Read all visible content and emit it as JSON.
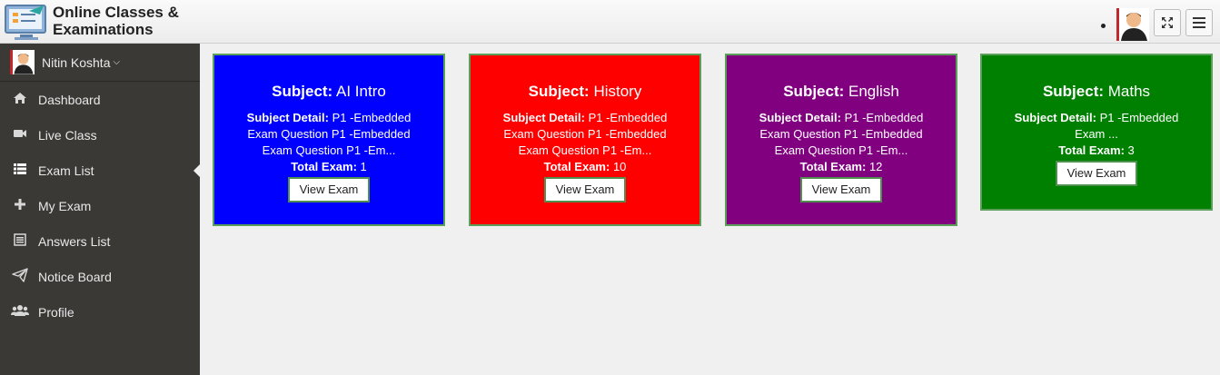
{
  "header": {
    "brand_line1": "Online Classes &",
    "brand_line2": "Examinations"
  },
  "sidebar": {
    "user_name": "Nitin Koshta",
    "items": [
      {
        "label": "Dashboard",
        "icon": "home-icon"
      },
      {
        "label": "Live Class",
        "icon": "video-camera-icon"
      },
      {
        "label": "Exam List",
        "icon": "list-icon",
        "active": true
      },
      {
        "label": "My Exam",
        "icon": "plus-icon"
      },
      {
        "label": "Answers List",
        "icon": "list-alt-icon"
      },
      {
        "label": "Notice Board",
        "icon": "paper-plane-icon"
      },
      {
        "label": "Profile",
        "icon": "users-icon"
      }
    ]
  },
  "labels": {
    "subject": "Subject:",
    "subject_detail": "Subject Detail:",
    "total_exam": "Total Exam:",
    "view_exam": "View Exam"
  },
  "cards": [
    {
      "subject": "AI Intro",
      "detail": "P1 -Embedded",
      "line2": "Exam Question P1 -Embedded",
      "line3": "Exam Question P1 -Em...",
      "total": "1",
      "color": "#0000ff"
    },
    {
      "subject": "History",
      "detail": "P1 -Embedded",
      "line2": "Exam Question P1 -Embedded",
      "line3": "Exam Question P1 -Em...",
      "total": "10",
      "color": "#ff0000"
    },
    {
      "subject": "English",
      "detail": "P1 -Embedded",
      "line2": "Exam Question P1 -Embedded",
      "line3": "Exam Question P1 -Em...",
      "total": "12",
      "color": "#800080"
    },
    {
      "subject": "Maths",
      "detail": "P1 -Embedded",
      "line2": "Exam ...",
      "total": "3",
      "color": "#008000"
    }
  ]
}
